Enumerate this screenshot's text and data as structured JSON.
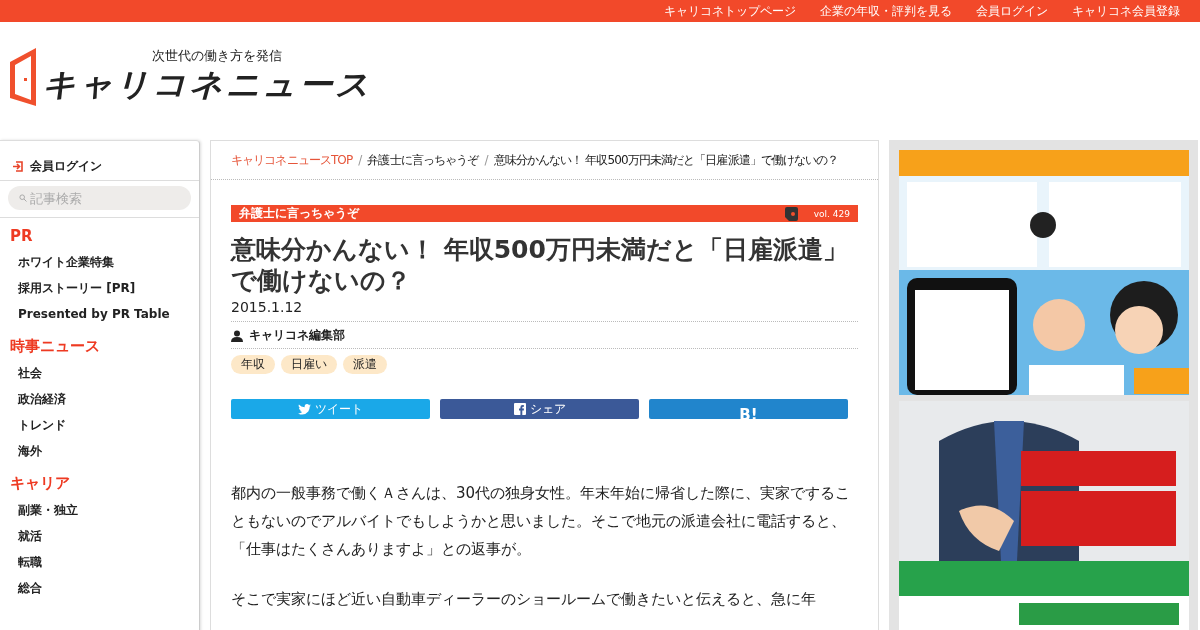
{
  "top_nav": [
    "キャリコネトップページ",
    "企業の年収・評判を見る",
    "会員ログイン",
    "キャリコネ会員登録"
  ],
  "header": {
    "tagline": "次世代の働き方を発信",
    "logo_text": "キャリコネニュース"
  },
  "sidebar": {
    "login": "会員ログイン",
    "search_placeholder": "記事検索",
    "sections": [
      {
        "title": "PR",
        "items": [
          "ホワイト企業特集",
          "採用ストーリー [PR]",
          "Presented by PR Table"
        ]
      },
      {
        "title": "時事ニュース",
        "items": [
          "社会",
          "政治経済",
          "トレンド",
          "海外"
        ]
      },
      {
        "title": "キャリア",
        "items": [
          "副業・独立",
          "就活",
          "転職",
          "総合"
        ]
      }
    ]
  },
  "breadcrumb_separator": "/",
  "breadcrumb": [
    "キャリコネニュースTOP",
    "弁護士に言っちゃうぞ",
    "意味分かんない！ 年収500万円未満だと「日雇派遣」で働けないの？"
  ],
  "article": {
    "series": "弁護士に言っちゃうぞ",
    "vol": "vol. 429",
    "title": "意味分かんない！ 年収500万円未満だと「日雇派遣」で働けないの？",
    "date": "2015.1.12",
    "author": "キャリコネ編集部",
    "tags": [
      "年収",
      "日雇い",
      "派遣"
    ],
    "share": [
      {
        "kind": "twitter",
        "label": "ツイート"
      },
      {
        "kind": "facebook",
        "label": "シェア"
      },
      {
        "kind": "hatena",
        "label": "B!"
      }
    ],
    "paragraphs": [
      "都内の一般事務で働くＡさんは、30代の独身女性。年末年始に帰省した際に、実家ですることもないのでアルバイトでもしようかと思いました。そこで地元の派遣会社に電話すると、「仕事はたくさんありますよ」との返事が。",
      "そこで実家にほど近い自動車ディーラーのショールームで働きたいと伝えると、急に年"
    ]
  },
  "ads": [
    {
      "kind": "picture"
    },
    {
      "kind": "picture"
    }
  ]
}
